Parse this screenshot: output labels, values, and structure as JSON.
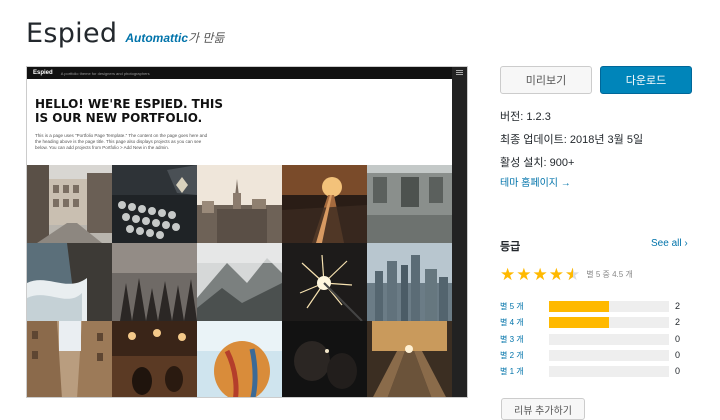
{
  "theme": {
    "title": "Espied",
    "author_name": "Automattic",
    "author_suffix": "가 만듦"
  },
  "preview": {
    "logo": "Espied",
    "tagline": "A portfolio theme for designers and photographers",
    "heading": "HELLO! WE'RE ESPIED. THIS IS OUR NEW PORTFOLIO.",
    "body": "This is a page uses \"Portfolio Page Template.\" The content on the page goes here and the heading above is the page title. This page also displays projects as you can see below. You can add projects from Portfolio > Add New in the admin.",
    "tiles": [
      "street-photo",
      "typewriter-photo",
      "city-skyline-photo",
      "train-tracks-sunset-photo",
      "building-photo",
      "ocean-waves-photo",
      "pine-forest-photo",
      "misty-mountain-photo",
      "sparkler-photo",
      "city-aerial-photo",
      "narrow-street-photo",
      "bar-interior-photo",
      "hot-air-balloon-photo",
      "dark-hands-photo",
      "escalator-photo"
    ]
  },
  "actions": {
    "preview_label": "미리보기",
    "download_label": "다운로드"
  },
  "meta": {
    "version": "버전: 1.2.3",
    "last_updated": "최종 업데이트: 2018년 3월 5일",
    "active_installs": "활성 설치: 900+",
    "homepage_link": "테마 홈페이지 →"
  },
  "ratings": {
    "heading": "등급",
    "see_all": "See all ›",
    "stars_text": "별 5 중 4.5 개",
    "stars_value": 4.5,
    "rows": [
      {
        "label": "별 5 개",
        "count": "2",
        "fraction": 0.5
      },
      {
        "label": "별 4 개",
        "count": "2",
        "fraction": 0.5
      },
      {
        "label": "별 3 개",
        "count": "0",
        "fraction": 0
      },
      {
        "label": "별 2 개",
        "count": "0",
        "fraction": 0
      },
      {
        "label": "별 1 개",
        "count": "0",
        "fraction": 0
      }
    ],
    "review_button": "리뷰 추가하기"
  },
  "colors": {
    "accent": "#0085ba",
    "link": "#0073aa",
    "star": "#ffb900"
  }
}
